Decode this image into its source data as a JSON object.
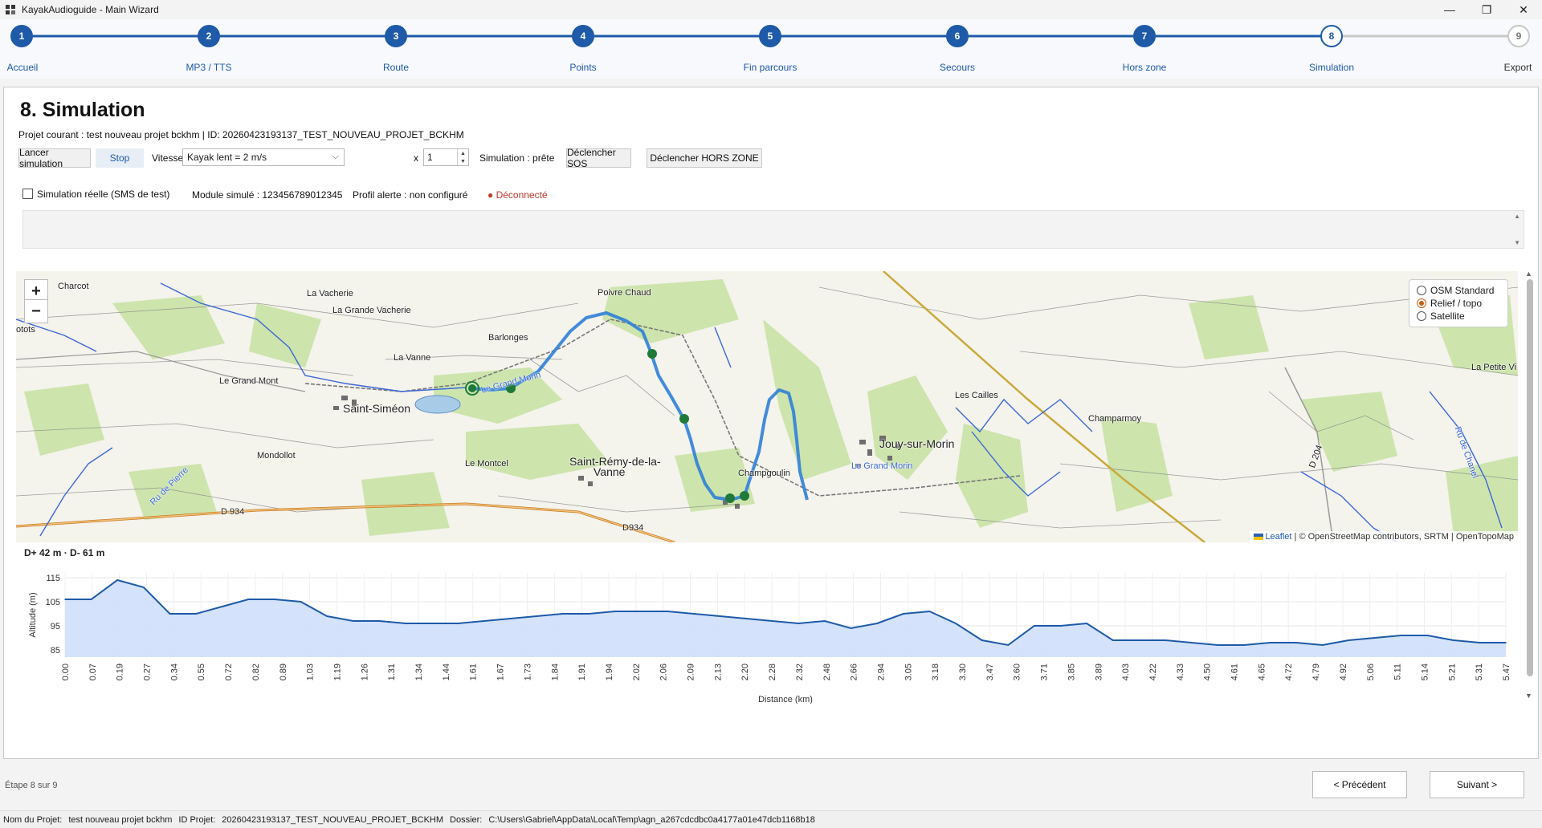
{
  "window": {
    "title": "KayakAudioguide - Main Wizard"
  },
  "steps": [
    {
      "num": "1",
      "label": "Accueil"
    },
    {
      "num": "2",
      "label": "MP3 / TTS"
    },
    {
      "num": "3",
      "label": "Route"
    },
    {
      "num": "4",
      "label": "Points"
    },
    {
      "num": "5",
      "label": "Fin parcours"
    },
    {
      "num": "6",
      "label": "Secours"
    },
    {
      "num": "7",
      "label": "Hors zone"
    },
    {
      "num": "8",
      "label": "Simulation"
    },
    {
      "num": "9",
      "label": "Export"
    }
  ],
  "current_step": 8,
  "page": {
    "title": "8. Simulation",
    "project_line": "Projet courant : test nouveau projet bckhm | ID: 20260423193137_TEST_NOUVEAU_PROJET_BCKHM"
  },
  "toolbar": {
    "start_label": "Lancer simulation",
    "stop_label": "Stop",
    "speed_label": "Vitesse",
    "speed_value": "Kayak lent = 2 m/s",
    "multiplier_label": "x",
    "multiplier_value": "1",
    "status": "Simulation : prête",
    "sos_label": "Déclencher SOS",
    "hors_zone_label": "Déclencher HORS ZONE"
  },
  "options": {
    "real_sim_label": "Simulation réelle (SMS de test)",
    "module": "Module simulé : 123456789012345",
    "profile": "Profil alerte : non configuré",
    "connection": "● Déconnecté",
    "connection_color": "#c0392b"
  },
  "map": {
    "zoom_in": "+",
    "zoom_out": "−",
    "layers": [
      {
        "label": "OSM Standard",
        "selected": false
      },
      {
        "label": "Relief / topo",
        "selected": true
      },
      {
        "label": "Satellite",
        "selected": false
      }
    ],
    "attribution_leaflet": "Leaflet",
    "attribution_rest": "| © OpenStreetMap contributors, SRTM | OpenTopoMap",
    "places": {
      "charcot": "Charcot",
      "vacherie": "La Vacherie",
      "grande_vacherie": "La Grande Vacherie",
      "otots": "otots",
      "poivre_chaud": "Poivre Chaud",
      "barlonges": "Barlonges",
      "la_vanne": "La Vanne",
      "grand_mont": "Le Grand Mont",
      "saint_simeon": "Saint-Siméon",
      "le_montcel": "Le Montcel",
      "saint_remy": "Saint-Rémy-de-la-",
      "vanne": "Vanne",
      "mondollot": "Mondollot",
      "d934": "D 934",
      "d934b": "D934",
      "champgoulin": "Champgoulin",
      "jouy": "Jouy-sur-Morin",
      "les_cailles": "Les Cailles",
      "champarmoy": "Champarmoy",
      "petite_vi": "La Petite Vi",
      "grand_morin": "Le Grand Morin",
      "grand_morin2": "Le Grand Morin",
      "d204": "D 204",
      "ru_pierre": "Ru de Pierre",
      "ru_chanel": "Ru de Chanel"
    }
  },
  "elevation": {
    "summary": "D+ 42 m · D- 61 m"
  },
  "chart_data": {
    "type": "area",
    "title": "",
    "xlabel": "Distance (km)",
    "ylabel": "Altitude (m)",
    "ylim": [
      82,
      117
    ],
    "yticks": [
      85,
      95,
      105,
      115
    ],
    "categories": [
      "0.00",
      "0.07",
      "0.19",
      "0.27",
      "0.34",
      "0.55",
      "0.72",
      "0.82",
      "0.89",
      "1.03",
      "1.19",
      "1.26",
      "1.31",
      "1.34",
      "1.44",
      "1.61",
      "1.67",
      "1.73",
      "1.84",
      "1.91",
      "1.94",
      "2.02",
      "2.06",
      "2.09",
      "2.13",
      "2.20",
      "2.28",
      "2.32",
      "2.48",
      "2.66",
      "2.94",
      "3.05",
      "3.18",
      "3.30",
      "3.47",
      "3.60",
      "3.71",
      "3.85",
      "3.89",
      "4.03",
      "4.22",
      "4.33",
      "4.50",
      "4.61",
      "4.65",
      "4.72",
      "4.79",
      "4.92",
      "5.06",
      "5.11",
      "5.14",
      "5.21",
      "5.31",
      "5.47"
    ],
    "values": [
      106,
      106,
      114,
      111,
      100,
      100,
      103,
      106,
      106,
      105,
      99,
      97,
      97,
      96,
      96,
      96,
      97,
      98,
      99,
      100,
      100,
      101,
      101,
      101,
      100,
      99,
      98,
      97,
      96,
      97,
      94,
      96,
      100,
      101,
      96,
      89,
      87,
      95,
      95,
      96,
      89,
      89,
      89,
      88,
      87,
      87,
      88,
      88,
      87,
      89,
      90,
      91,
      91,
      89,
      88,
      88
    ]
  },
  "footer": {
    "step_count": "Étape 8 sur 9",
    "prev_label": "< Précédent",
    "next_label": "Suivant >"
  },
  "statusbar": {
    "name_label": "Nom du Projet:",
    "name_value": "test nouveau projet bckhm",
    "id_label": "ID Projet:",
    "id_value": "20260423193137_TEST_NOUVEAU_PROJET_BCKHM",
    "folder_label": "Dossier:",
    "folder_value": "C:\\Users\\Gabriel\\AppData\\Local\\Temp\\agn_a267cdcdbc0a4177a01e47dcb1168b18"
  },
  "colors": {
    "accent": "#1e5aa8",
    "route": "#2f7fd8",
    "marker": "#1f7a3a"
  }
}
